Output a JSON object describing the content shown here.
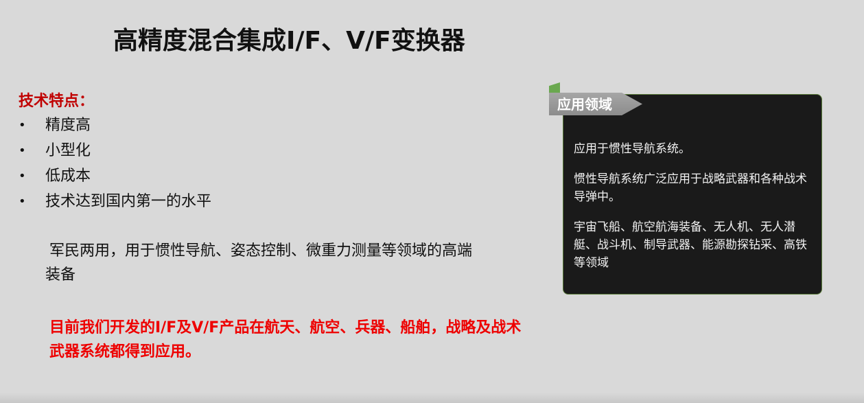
{
  "title": "高精度混合集成I/F、V/F变换器",
  "features": {
    "heading": "技术特点：",
    "bullet_symbol": "•",
    "items": [
      "精度高",
      "小型化",
      "低成本",
      "技术达到国内第一的水平"
    ]
  },
  "paragraph1": "军民两用，用于惯性导航、姿态控制、微重力测量等领域的高端装备",
  "paragraph2": "目前我们开发的I/F及V/F产品在航天、航空、兵器、船舶，战略及战术武器系统都得到应用。",
  "application": {
    "tab_label": "应用领域",
    "lines": [
      "应用于惯性导航系统。",
      "惯性导航系统广泛应用于战略武器和各种战术导弹中。",
      "宇宙飞船、航空航海装备、无人机、无人潜艇、战斗机、制导武器、能源勘探钻采、高铁等领域"
    ]
  },
  "colors": {
    "background": "#d9d9d9",
    "heading_red": "#c00000",
    "highlight_red": "#ee0000",
    "panel_bg": "#1a1a1a",
    "panel_border": "#5b7d3a",
    "tab_gray": "#999999",
    "flag_green": "#6aa84f"
  }
}
